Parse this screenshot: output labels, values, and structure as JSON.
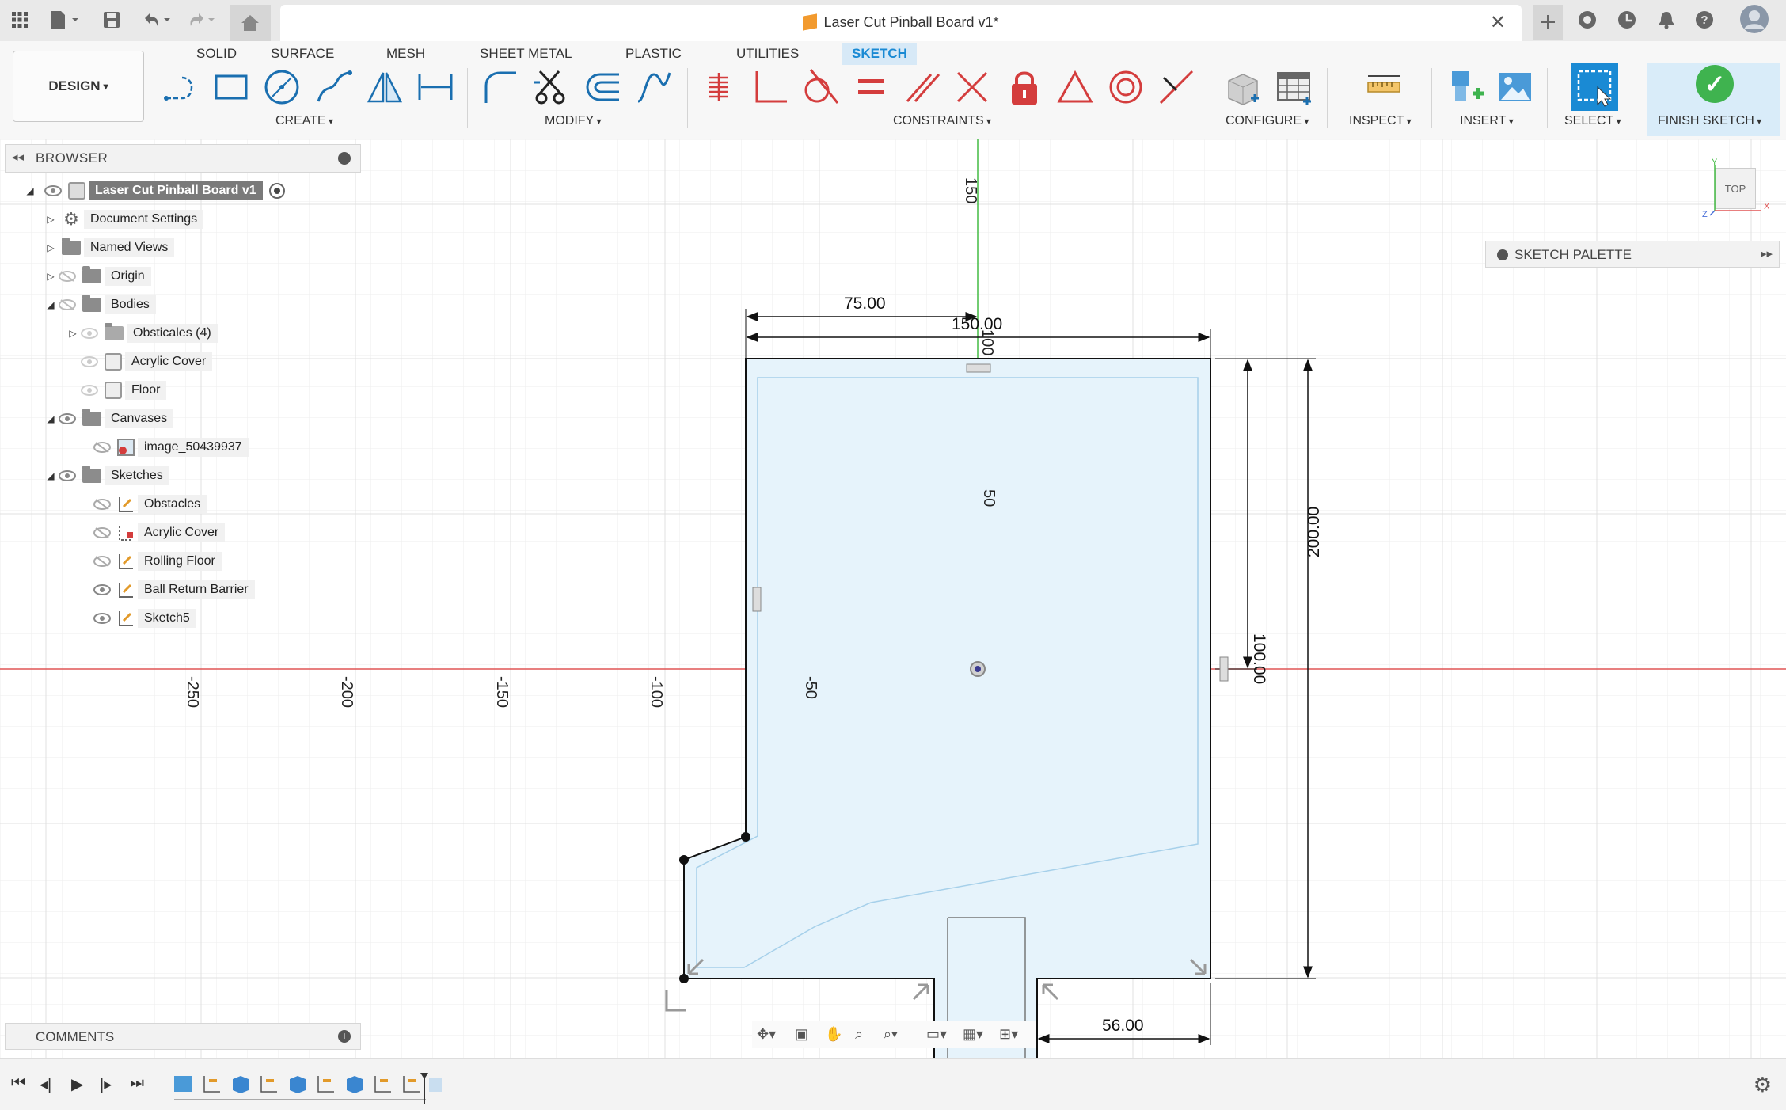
{
  "window": {
    "title": "Laser Cut Pinball Board v1*",
    "close_icon": "close-icon"
  },
  "toolbar": {
    "workspace": "DESIGN",
    "tabs": [
      {
        "label": "SOLID"
      },
      {
        "label": "SURFACE"
      },
      {
        "label": "MESH"
      },
      {
        "label": "SHEET METAL"
      },
      {
        "label": "PLASTIC"
      },
      {
        "label": "UTILITIES"
      },
      {
        "label": "SKETCH"
      }
    ],
    "active_tab": "SKETCH",
    "groups": {
      "create": "CREATE",
      "modify": "MODIFY",
      "constraints": "CONSTRAINTS",
      "configure": "CONFIGURE",
      "inspect": "INSPECT",
      "insert": "INSERT",
      "select": "SELECT",
      "finish": "FINISH SKETCH"
    }
  },
  "browser": {
    "title": "BROWSER",
    "root": "Laser Cut Pinball Board v1",
    "items": [
      {
        "label": "Document Settings"
      },
      {
        "label": "Named Views"
      },
      {
        "label": "Origin"
      },
      {
        "label": "Bodies"
      },
      {
        "label": "Obsticales (4)"
      },
      {
        "label": "Acrylic Cover"
      },
      {
        "label": "Floor"
      },
      {
        "label": "Canvases"
      },
      {
        "label": "image_50439937"
      },
      {
        "label": "Sketches"
      },
      {
        "label": "Obstacles"
      },
      {
        "label": "Acrylic Cover"
      },
      {
        "label": "Rolling Floor"
      },
      {
        "label": "Ball Return Barrier"
      },
      {
        "label": "Sketch5"
      }
    ]
  },
  "comments": {
    "title": "COMMENTS"
  },
  "palette": {
    "title": "SKETCH PALETTE"
  },
  "viewcube": {
    "face": "TOP"
  },
  "sketch": {
    "dimensions": {
      "d75": "75.00",
      "d150": "150.00",
      "d100": "100.00",
      "d200": "200.00",
      "d56": "56.00"
    },
    "axis_labels": {
      "y150": "150",
      "y100": "100",
      "y50": "50",
      "x_250": "-250",
      "x_200": "-200",
      "x_150": "-150",
      "x_100": "-100",
      "x_50": "-50"
    }
  },
  "colors": {
    "accent": "#1a8ad4",
    "finish_green": "#3fb34f",
    "x_axis": "#e05555",
    "y_axis": "#44bb44",
    "profile_fill": "#e6f3fb"
  }
}
